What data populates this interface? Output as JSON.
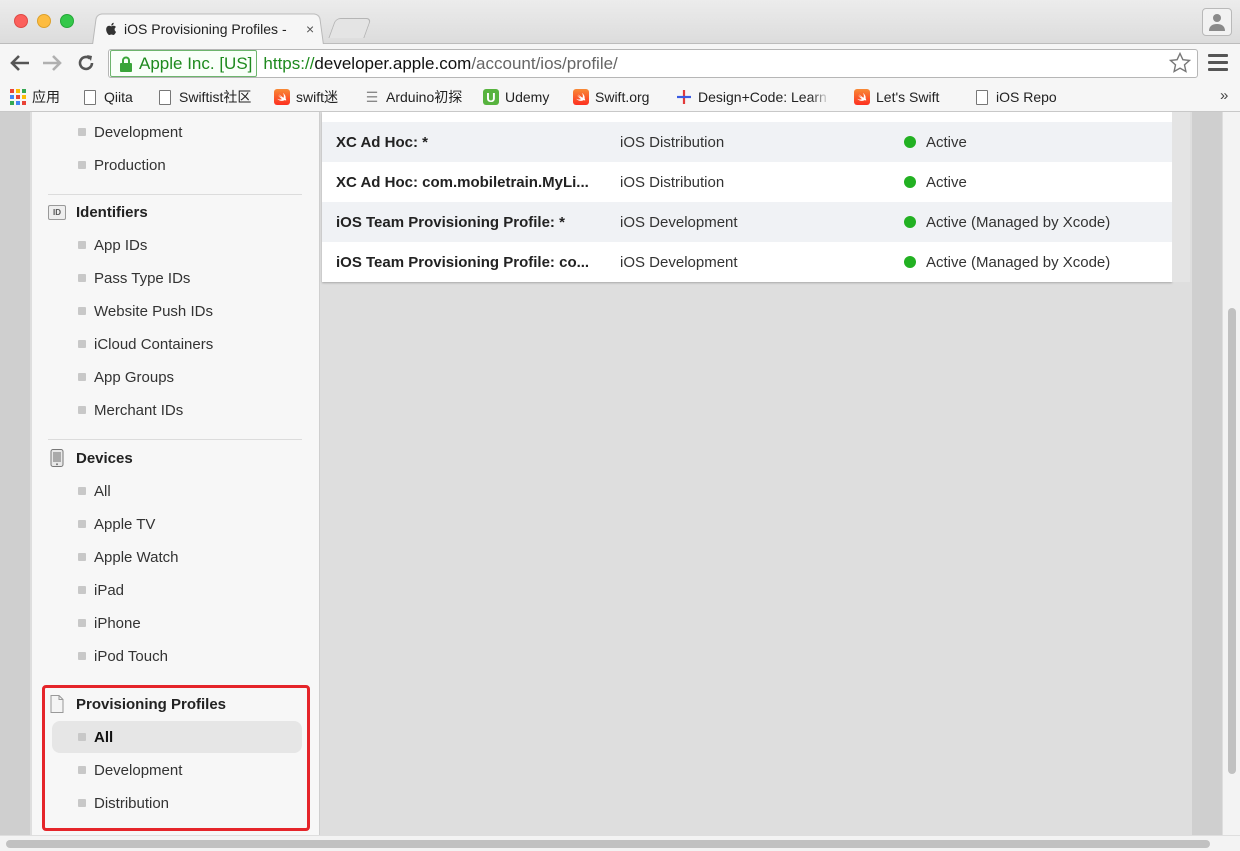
{
  "browser": {
    "tab_title": "iOS Provisioning Profiles -",
    "tab_close": "×",
    "ev_label": "Apple Inc. [US]",
    "url_scheme": "https://",
    "url_host": "developer.apple.com",
    "url_path": "/account/ios/profile/"
  },
  "bookmarks": [
    {
      "label": "应用",
      "icon": "apps-icon"
    },
    {
      "label": "Qiita",
      "icon": "page-icon"
    },
    {
      "label": "Swiftist社区",
      "icon": "page-icon"
    },
    {
      "label": "swift迷",
      "icon": "swift-icon"
    },
    {
      "label": "Arduino初探",
      "icon": "bars-icon"
    },
    {
      "label": "Udemy",
      "icon": "udemy-icon",
      "glyph": "U"
    },
    {
      "label": "Swift.org",
      "icon": "swift-icon"
    },
    {
      "label": "Design+Code: Learn",
      "icon": "plus-icon"
    },
    {
      "label": "Let's Swift",
      "icon": "swift-icon"
    },
    {
      "label": "iOS Repo",
      "icon": "page-icon"
    }
  ],
  "bookmarks_more": "»",
  "sidebar": {
    "certificates_items": [
      "Development",
      "Production"
    ],
    "identifiers": {
      "title": "Identifiers",
      "badge": "ID",
      "items": [
        "App IDs",
        "Pass Type IDs",
        "Website Push IDs",
        "iCloud Containers",
        "App Groups",
        "Merchant IDs"
      ]
    },
    "devices": {
      "title": "Devices",
      "items": [
        "All",
        "Apple TV",
        "Apple Watch",
        "iPad",
        "iPhone",
        "iPod Touch"
      ]
    },
    "profiles": {
      "title": "Provisioning Profiles",
      "items": [
        "All",
        "Development",
        "Distribution"
      ],
      "selected": "All"
    }
  },
  "table": {
    "rows": [
      {
        "name": "XC Ad Hoc: *",
        "type": "iOS Distribution",
        "status": "Active"
      },
      {
        "name": "XC Ad Hoc: com.mobiletrain.MyLi...",
        "type": "iOS Distribution",
        "status": "Active"
      },
      {
        "name": "iOS Team Provisioning Profile: *",
        "type": "iOS Development",
        "status": "Active (Managed by Xcode)"
      },
      {
        "name": "iOS Team Provisioning Profile: co...",
        "type": "iOS Development",
        "status": "Active (Managed by Xcode)"
      }
    ]
  },
  "colors": {
    "status_active": "#22b122",
    "highlight": "#e5252a",
    "ev_green": "#1e8a1e"
  }
}
